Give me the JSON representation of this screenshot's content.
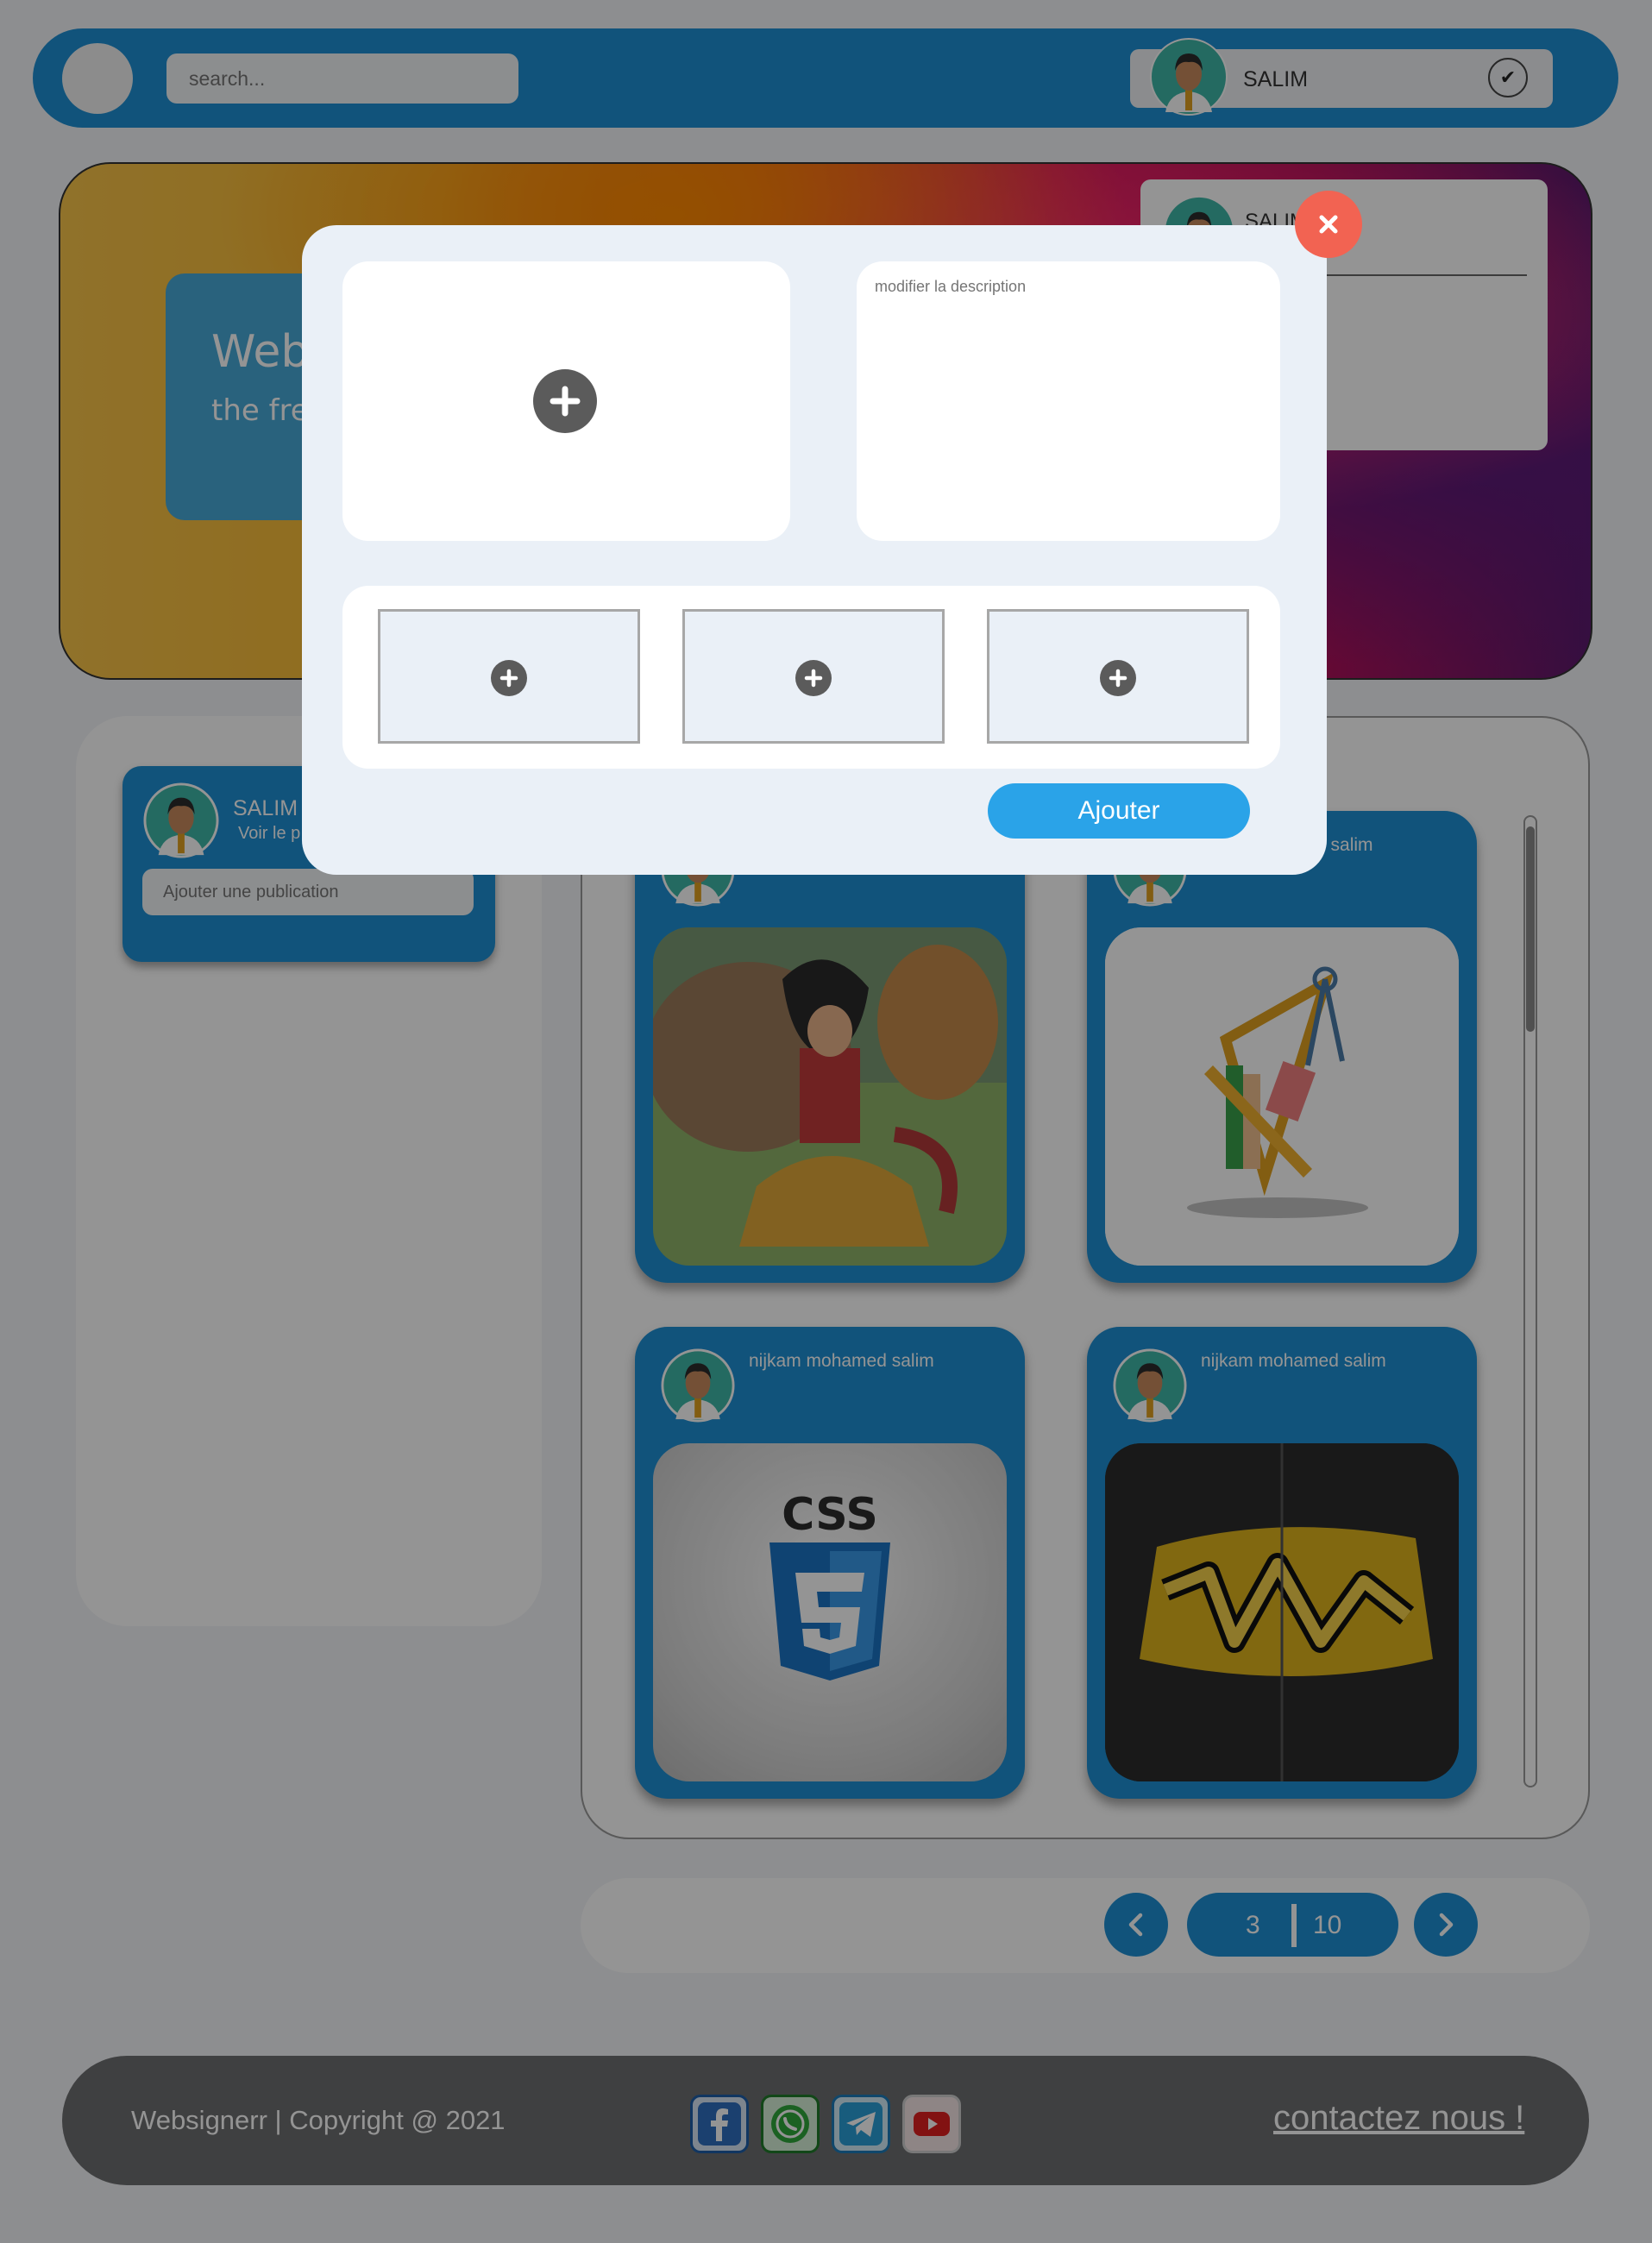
{
  "header": {
    "search_placeholder": "search...",
    "user_name": "SALIM"
  },
  "hero": {
    "title": "Web",
    "subtitle": "the fre future",
    "profile_name": "SALIM"
  },
  "profile_card": {
    "name": "SALIM",
    "link": "Voir le p",
    "publish_placeholder": "Ajouter une publication"
  },
  "posts": [
    {
      "author": "",
      "image": "anime-illustration"
    },
    {
      "author": "d salim",
      "image": "design-tools-illustration"
    },
    {
      "author": "nijkam mohamed salim",
      "image": "css3-logo"
    },
    {
      "author": "nijkam mohamed salim",
      "image": "graffiti-hoodie"
    }
  ],
  "pagination": {
    "current": "3",
    "total": "10"
  },
  "footer": {
    "copyright": "Websignerr | Copyright @ 2021",
    "contact": "contactez nous !",
    "social_icons": [
      "facebook-icon",
      "whatsapp-icon",
      "telegram-icon",
      "youtube-icon"
    ]
  },
  "modal": {
    "description_placeholder": "modifier la description",
    "submit_label": "Ajouter"
  },
  "colors": {
    "primary": "#1e90d4",
    "close": "#f26352",
    "submit": "#2aa3e8"
  }
}
